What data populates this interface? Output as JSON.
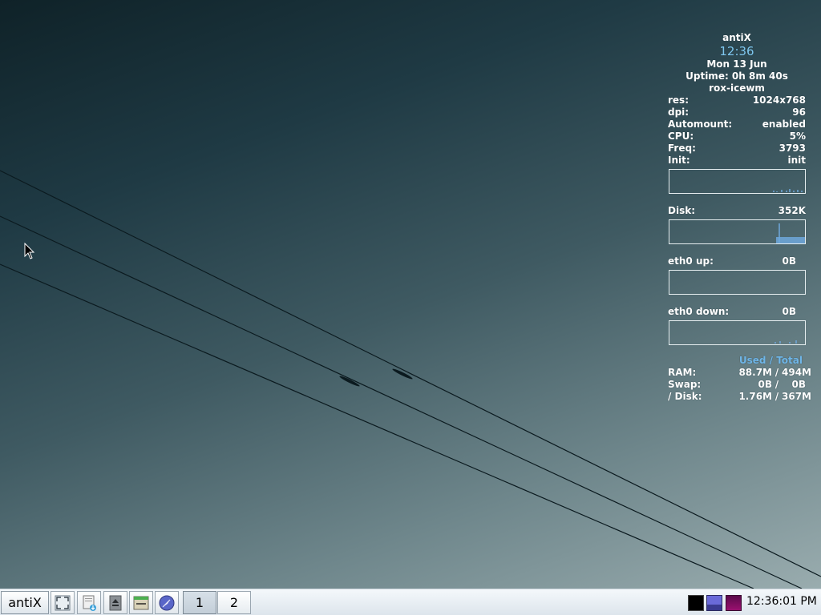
{
  "conky": {
    "hostname": "antiX",
    "time": "12:36",
    "date": "Mon 13 Jun",
    "uptime": "Uptime: 0h 8m 40s",
    "session": "rox-icewm",
    "res": {
      "label": "res:",
      "value": "1024x768"
    },
    "dpi": {
      "label": "dpi:",
      "value": "96"
    },
    "automount": {
      "label": "Automount:",
      "value": "enabled"
    },
    "cpu": {
      "label": "CPU:",
      "value": "5%"
    },
    "freq": {
      "label": "Freq:",
      "value": "3793"
    },
    "init": {
      "label": "Init:",
      "value": "init"
    },
    "disk": {
      "label": "Disk:",
      "value": "352K"
    },
    "eth_up": {
      "label": "eth0 up:",
      "value": "0B"
    },
    "eth_down": {
      "label": "eth0 down:",
      "value": "0B"
    },
    "mem_header": "Used / Total",
    "ram": {
      "label": "RAM:",
      "used": "88.7M",
      "sep": "/",
      "total": "494M"
    },
    "swap": {
      "label": "Swap:",
      "used": "0B",
      "sep": "/",
      "total": "0B"
    },
    "rootdisk": {
      "label": "/ Disk:",
      "used": "1.76M",
      "sep": "/",
      "total": "367M"
    },
    "colors": {
      "accent": "#7ec8f0",
      "graph": "#6fa8dc"
    }
  },
  "taskbar": {
    "start_label": "antiX",
    "quicklaunch": [
      {
        "icon": "fullscreen-icon"
      },
      {
        "icon": "file-manager-icon"
      },
      {
        "icon": "eject-icon"
      },
      {
        "icon": "window-list-icon"
      },
      {
        "icon": "web-browser-icon"
      }
    ],
    "workspaces": [
      "1",
      "2"
    ],
    "active_workspace": "1",
    "tray": [
      {
        "icon": "cpu-monitor-icon"
      },
      {
        "icon": "network-monitor-icon"
      },
      {
        "icon": "memory-monitor-icon"
      }
    ],
    "clock": "12:36:01 PM"
  }
}
